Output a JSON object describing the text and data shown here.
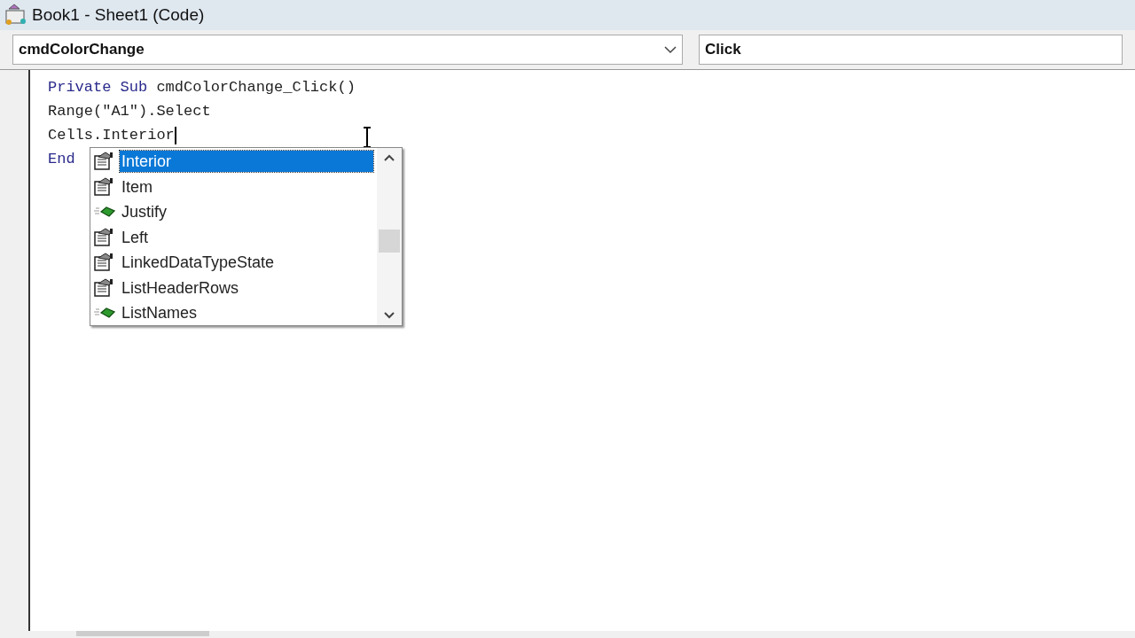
{
  "window": {
    "title": "Book1 - Sheet1 (Code)"
  },
  "object_combo": {
    "value": "cmdColorChange"
  },
  "procedure_combo": {
    "value": "Click"
  },
  "code_lines": [
    {
      "tokens": [
        {
          "text": "Private Sub",
          "kind": "keyword"
        },
        {
          "text": " cmdColorChange_Click()",
          "kind": "plain"
        }
      ]
    },
    {
      "tokens": [
        {
          "text": "Range(\"A1\").Select",
          "kind": "plain"
        }
      ]
    },
    {
      "tokens": [
        {
          "text": "Cells.Interior",
          "kind": "plain"
        }
      ],
      "caret": true
    },
    {
      "tokens": [
        {
          "text": "End",
          "kind": "keyword"
        }
      ]
    }
  ],
  "autocomplete": {
    "items": [
      {
        "label": "Interior",
        "kind": "property",
        "selected": true
      },
      {
        "label": "Item",
        "kind": "property",
        "selected": false
      },
      {
        "label": "Justify",
        "kind": "method",
        "selected": false
      },
      {
        "label": "Left",
        "kind": "property",
        "selected": false
      },
      {
        "label": "LinkedDataTypeState",
        "kind": "property",
        "selected": false
      },
      {
        "label": "ListHeaderRows",
        "kind": "property",
        "selected": false
      },
      {
        "label": "ListNames",
        "kind": "method",
        "selected": false
      }
    ]
  }
}
